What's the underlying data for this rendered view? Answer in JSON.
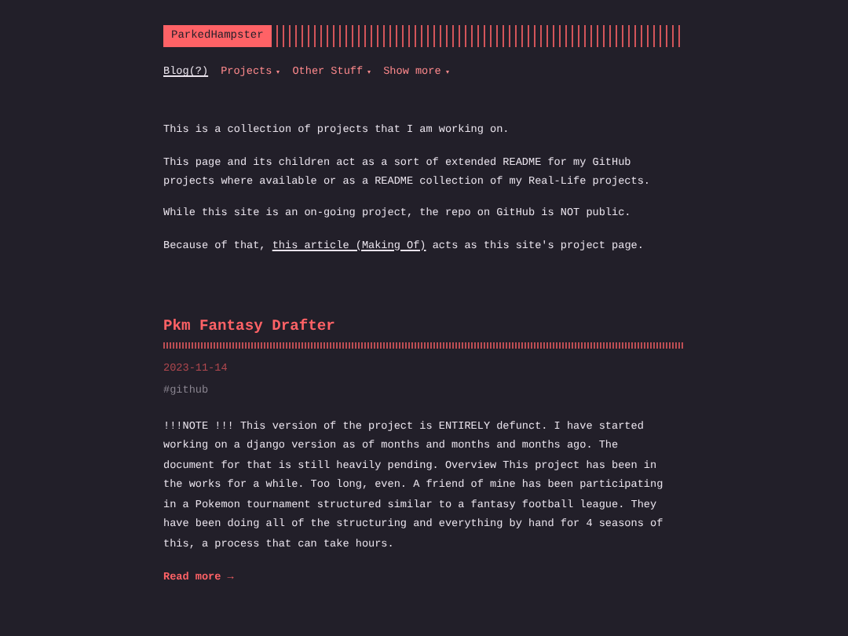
{
  "header": {
    "logo": "ParkedHampster"
  },
  "nav": [
    {
      "label": "Blog(?)",
      "selected": true,
      "has_menu": false
    },
    {
      "label": "Projects",
      "selected": false,
      "has_menu": true
    },
    {
      "label": "Other Stuff",
      "selected": false,
      "has_menu": true
    },
    {
      "label": "Show more",
      "selected": false,
      "has_menu": true
    }
  ],
  "intro": [
    {
      "text": "This is a collection of projects that I am working on."
    },
    {
      "text": "This page and its children act as a sort of extended README for my GitHub projects where available or as a README collection of my Real-Life projects."
    },
    {
      "text": "While this site is an on-going project, the repo on GitHub is NOT public."
    },
    {
      "text": "Because of that, ",
      "link": "this article (Making Of)",
      "after": " acts as this site's project page."
    }
  ],
  "posts": [
    {
      "title": "Pkm Fantasy Drafter",
      "date": "2023-11-14",
      "tag": "#github",
      "summary": "!!!NOTE !!! This version of the project is ENTIRELY defunct. I have started working on a django version as of months and months and months ago. The document for that is still heavily pending. Overview This project has been in the works for a while. Too long, even. A friend of mine has been participating in a Pokemon tournament structured similar to a fantasy football league. They have been doing all of the structuring and everything by hand for 4 seasons of this, a process that can take hours.",
      "read_more": "Read more →"
    }
  ]
}
